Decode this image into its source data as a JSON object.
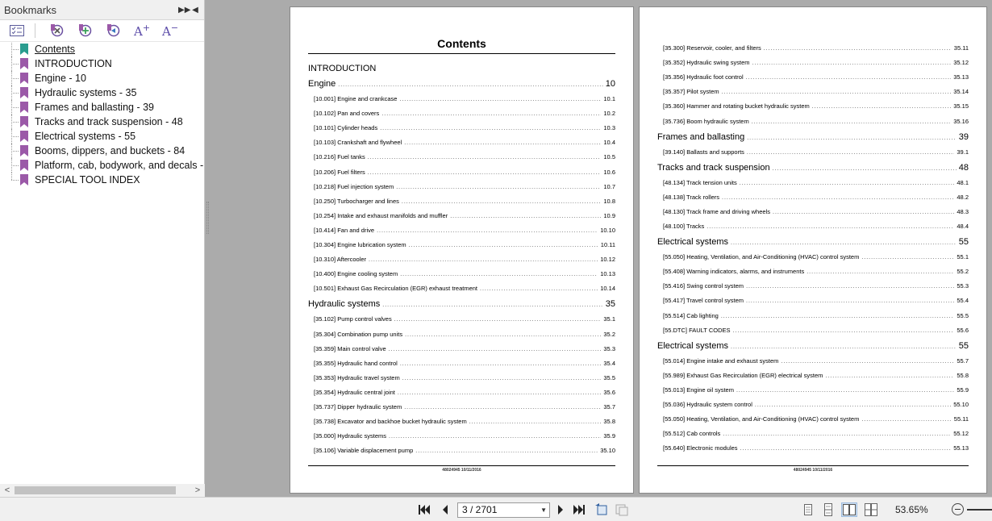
{
  "sidebar": {
    "title": "Bookmarks",
    "toolbar": {
      "increase_font": "A",
      "decrease_font": "A",
      "plus": "+",
      "minus": "−"
    },
    "bookmarks": [
      {
        "label": "Contents",
        "active": true
      },
      {
        "label": "INTRODUCTION"
      },
      {
        "label": "Engine - 10"
      },
      {
        "label": "Hydraulic systems - 35"
      },
      {
        "label": "Frames and ballasting - 39"
      },
      {
        "label": "Tracks and track suspension - 48"
      },
      {
        "label": "Electrical systems - 55"
      },
      {
        "label": "Booms, dippers, and buckets - 84"
      },
      {
        "label": "Platform, cab, bodywork, and decals -"
      },
      {
        "label": "SPECIAL TOOL INDEX"
      }
    ],
    "bookmark_icon_color": "#9b59a8",
    "active_icon_color": "#2a9d8f"
  },
  "left_page": {
    "title": "Contents",
    "footer": "48024945 10/11/2016",
    "rows": [
      {
        "kind": "intro",
        "title": "INTRODUCTION",
        "page": ""
      },
      {
        "kind": "sec",
        "title": "Engine",
        "page": "10"
      },
      {
        "kind": "sub",
        "title": "[10.001] Engine and crankcase",
        "page": "10.1"
      },
      {
        "kind": "sub",
        "title": "[10.102] Pan and covers",
        "page": "10.2"
      },
      {
        "kind": "sub",
        "title": "[10.101] Cylinder heads",
        "page": "10.3"
      },
      {
        "kind": "sub",
        "title": "[10.103] Crankshaft and flywheel",
        "page": "10.4"
      },
      {
        "kind": "sub",
        "title": "[10.216] Fuel tanks",
        "page": "10.5"
      },
      {
        "kind": "sub",
        "title": "[10.206] Fuel filters",
        "page": "10.6"
      },
      {
        "kind": "sub",
        "title": "[10.218] Fuel injection system",
        "page": "10.7"
      },
      {
        "kind": "sub",
        "title": "[10.250] Turbocharger and lines",
        "page": "10.8"
      },
      {
        "kind": "sub",
        "title": "[10.254] Intake and exhaust manifolds and muffler",
        "page": "10.9"
      },
      {
        "kind": "sub",
        "title": "[10.414] Fan and drive",
        "page": "10.10"
      },
      {
        "kind": "sub",
        "title": "[10.304] Engine lubrication system",
        "page": "10.11"
      },
      {
        "kind": "sub",
        "title": "[10.310] Aftercooler",
        "page": "10.12"
      },
      {
        "kind": "sub",
        "title": "[10.400] Engine cooling system",
        "page": "10.13"
      },
      {
        "kind": "sub",
        "title": "[10.501] Exhaust Gas Recirculation (EGR) exhaust treatment",
        "page": "10.14"
      },
      {
        "kind": "sec",
        "title": "Hydraulic systems",
        "page": "35"
      },
      {
        "kind": "sub",
        "title": "[35.102] Pump control valves",
        "page": "35.1"
      },
      {
        "kind": "sub",
        "title": "[35.304] Combination pump units",
        "page": "35.2"
      },
      {
        "kind": "sub",
        "title": "[35.359] Main control valve",
        "page": "35.3"
      },
      {
        "kind": "sub",
        "title": "[35.355] Hydraulic hand control",
        "page": "35.4"
      },
      {
        "kind": "sub",
        "title": "[35.353] Hydraulic travel system",
        "page": "35.5"
      },
      {
        "kind": "sub",
        "title": "[35.354] Hydraulic central joint",
        "page": "35.6"
      },
      {
        "kind": "sub",
        "title": "[35.737] Dipper hydraulic system",
        "page": "35.7"
      },
      {
        "kind": "sub",
        "title": "[35.738] Excavator and backhoe bucket hydraulic system",
        "page": "35.8"
      },
      {
        "kind": "sub",
        "title": "[35.000] Hydraulic systems",
        "page": "35.9"
      },
      {
        "kind": "sub",
        "title": "[35.106] Variable displacement pump",
        "page": "35.10"
      }
    ]
  },
  "right_page": {
    "footer": "48024945 10/11/2016",
    "rows": [
      {
        "kind": "sub",
        "title": "[35.300] Reservoir, cooler, and filters",
        "page": "35.11"
      },
      {
        "kind": "sub",
        "title": "[35.352] Hydraulic swing system",
        "page": "35.12"
      },
      {
        "kind": "sub",
        "title": "[35.356] Hydraulic foot control",
        "page": "35.13"
      },
      {
        "kind": "sub",
        "title": "[35.357] Pilot system",
        "page": "35.14"
      },
      {
        "kind": "sub",
        "title": "[35.360] Hammer and rotating bucket hydraulic system",
        "page": "35.15"
      },
      {
        "kind": "sub",
        "title": "[35.736] Boom hydraulic system",
        "page": "35.16"
      },
      {
        "kind": "sec",
        "title": "Frames and ballasting",
        "page": "39"
      },
      {
        "kind": "sub",
        "title": "[39.140] Ballasts and supports",
        "page": "39.1"
      },
      {
        "kind": "sec",
        "title": "Tracks and track suspension",
        "page": "48"
      },
      {
        "kind": "sub",
        "title": "[48.134] Track tension units",
        "page": "48.1"
      },
      {
        "kind": "sub",
        "title": "[48.138] Track rollers",
        "page": "48.2"
      },
      {
        "kind": "sub",
        "title": "[48.130] Track frame and driving wheels",
        "page": "48.3"
      },
      {
        "kind": "sub",
        "title": "[48.100] Tracks",
        "page": "48.4"
      },
      {
        "kind": "sec",
        "title": "Electrical systems",
        "page": "55"
      },
      {
        "kind": "sub",
        "title": "[55.050] Heating, Ventilation, and Air-Conditioning (HVAC) control system",
        "page": "55.1"
      },
      {
        "kind": "sub",
        "title": "[55.408] Warning indicators, alarms, and instruments",
        "page": "55.2"
      },
      {
        "kind": "sub",
        "title": "[55.416] Swing control system",
        "page": "55.3"
      },
      {
        "kind": "sub",
        "title": "[55.417] Travel control system",
        "page": "55.4"
      },
      {
        "kind": "sub",
        "title": "[55.514] Cab lighting",
        "page": "55.5"
      },
      {
        "kind": "sub",
        "title": "[55.DTC] FAULT CODES",
        "page": "55.6"
      },
      {
        "kind": "sec",
        "title": "Electrical systems",
        "page": "55"
      },
      {
        "kind": "sub",
        "title": "[55.014] Engine intake and exhaust system",
        "page": "55.7"
      },
      {
        "kind": "sub",
        "title": "[55.989] Exhaust Gas Recirculation (EGR) electrical system",
        "page": "55.8"
      },
      {
        "kind": "sub",
        "title": "[55.013] Engine oil system",
        "page": "55.9"
      },
      {
        "kind": "sub",
        "title": "[55.036] Hydraulic system control",
        "page": "55.10"
      },
      {
        "kind": "sub",
        "title": "[55.050] Heating, Ventilation, and Air-Conditioning (HVAC) control system",
        "page": "55.11"
      },
      {
        "kind": "sub",
        "title": "[55.512] Cab controls",
        "page": "55.12"
      },
      {
        "kind": "sub",
        "title": "[55.640] Electronic modules",
        "page": "55.13"
      }
    ]
  },
  "bottombar": {
    "page_indicator": "3 / 2701",
    "zoom": "53.65%"
  }
}
